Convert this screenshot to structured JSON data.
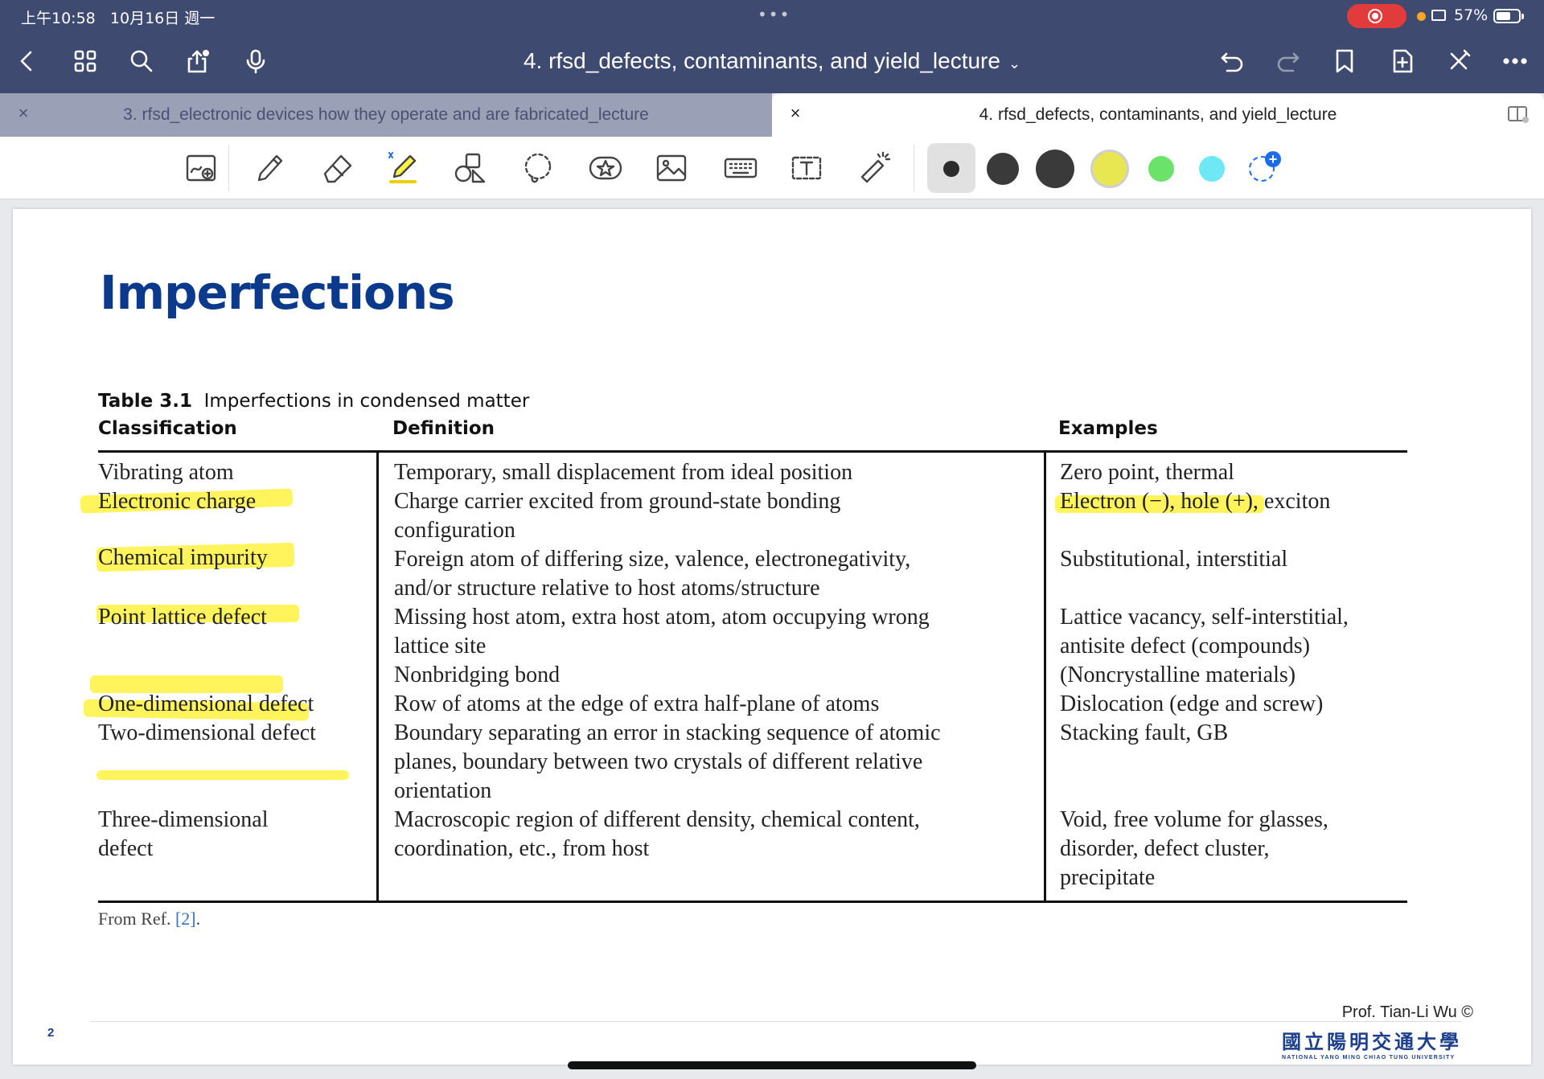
{
  "status": {
    "time": "上午10:58",
    "date": "10月16日 週一",
    "dots": "•••",
    "battery": "57%"
  },
  "nav": {
    "title": "4. rfsd_defects, contaminants, and yield_lecture",
    "title_chevron": "⌄"
  },
  "tabs": [
    {
      "label": "3. rfsd_electronic devices how they operate and are fabricated_lecture",
      "close": "×"
    },
    {
      "label": "4. rfsd_defects, contaminants, and yield_lecture",
      "close": "×"
    }
  ],
  "toolbar": {
    "colors": {
      "black_small": "#2b2b2b",
      "black_medium": "#3a3a3a",
      "black_large": "#3a3a3a",
      "yellow": "#e8e651",
      "green": "#6be36b",
      "cyan": "#6ee8f5",
      "add": "#1e6be8"
    }
  },
  "slide": {
    "title": "Imperfections",
    "table": {
      "caption_label": "Table 3.1",
      "caption_text": "Imperfections in condensed matter",
      "headers": [
        "Classification",
        "Definition",
        "Examples"
      ],
      "rows": [
        {
          "classification": [
            "Vibrating atom"
          ],
          "definition": [
            "Temporary, small displacement from ideal position"
          ],
          "examples": [
            "Zero point, thermal"
          ]
        },
        {
          "classification": [
            "Electronic charge"
          ],
          "definition": [
            "Charge carrier excited from ground-state bonding",
            "configuration"
          ],
          "examples": [
            "Electron (−), hole (+), exciton"
          ]
        },
        {
          "classification": [
            "Chemical impurity"
          ],
          "definition": [
            "Foreign atom of differing size, valence, electronegativity,",
            "and/or structure relative to host atoms/structure"
          ],
          "examples": [
            "Substitutional, interstitial"
          ]
        },
        {
          "classification": [
            "Point lattice defect"
          ],
          "definition": [
            "Missing host atom, extra host atom, atom occupying wrong",
            "lattice site",
            "Nonbridging bond"
          ],
          "examples": [
            "Lattice vacancy, self-interstitial,",
            "antisite defect (compounds)",
            "(Noncrystalline materials)"
          ]
        },
        {
          "classification": [
            "One-dimensional defect"
          ],
          "definition": [
            "Row of atoms at the edge of extra half-plane of atoms"
          ],
          "examples": [
            "Dislocation (edge and screw)"
          ]
        },
        {
          "classification": [
            "Two-dimensional defect"
          ],
          "definition": [
            "Boundary separating an error in stacking sequence of atomic",
            "planes, boundary between two crystals of different relative",
            "orientation"
          ],
          "examples": [
            "Stacking fault, GB"
          ]
        },
        {
          "classification": [
            "Three-dimensional",
            "defect"
          ],
          "definition": [
            "Macroscopic region of different density, chemical content,",
            "coordination, etc., from host"
          ],
          "examples": [
            "Void, free volume for glasses,",
            "disorder, defect cluster,",
            "precipitate"
          ]
        }
      ],
      "source_prefix": "From Ref.",
      "source_ref": "[2]",
      "source_suffix": "."
    },
    "page_number": "2",
    "author": "Prof. Tian-Li Wu ©",
    "university_cn": "國立陽明交通大學",
    "university_en": "NATIONAL YANG MING CHIAO TUNG UNIVERSITY",
    "highlight_color": "#fff34a"
  }
}
